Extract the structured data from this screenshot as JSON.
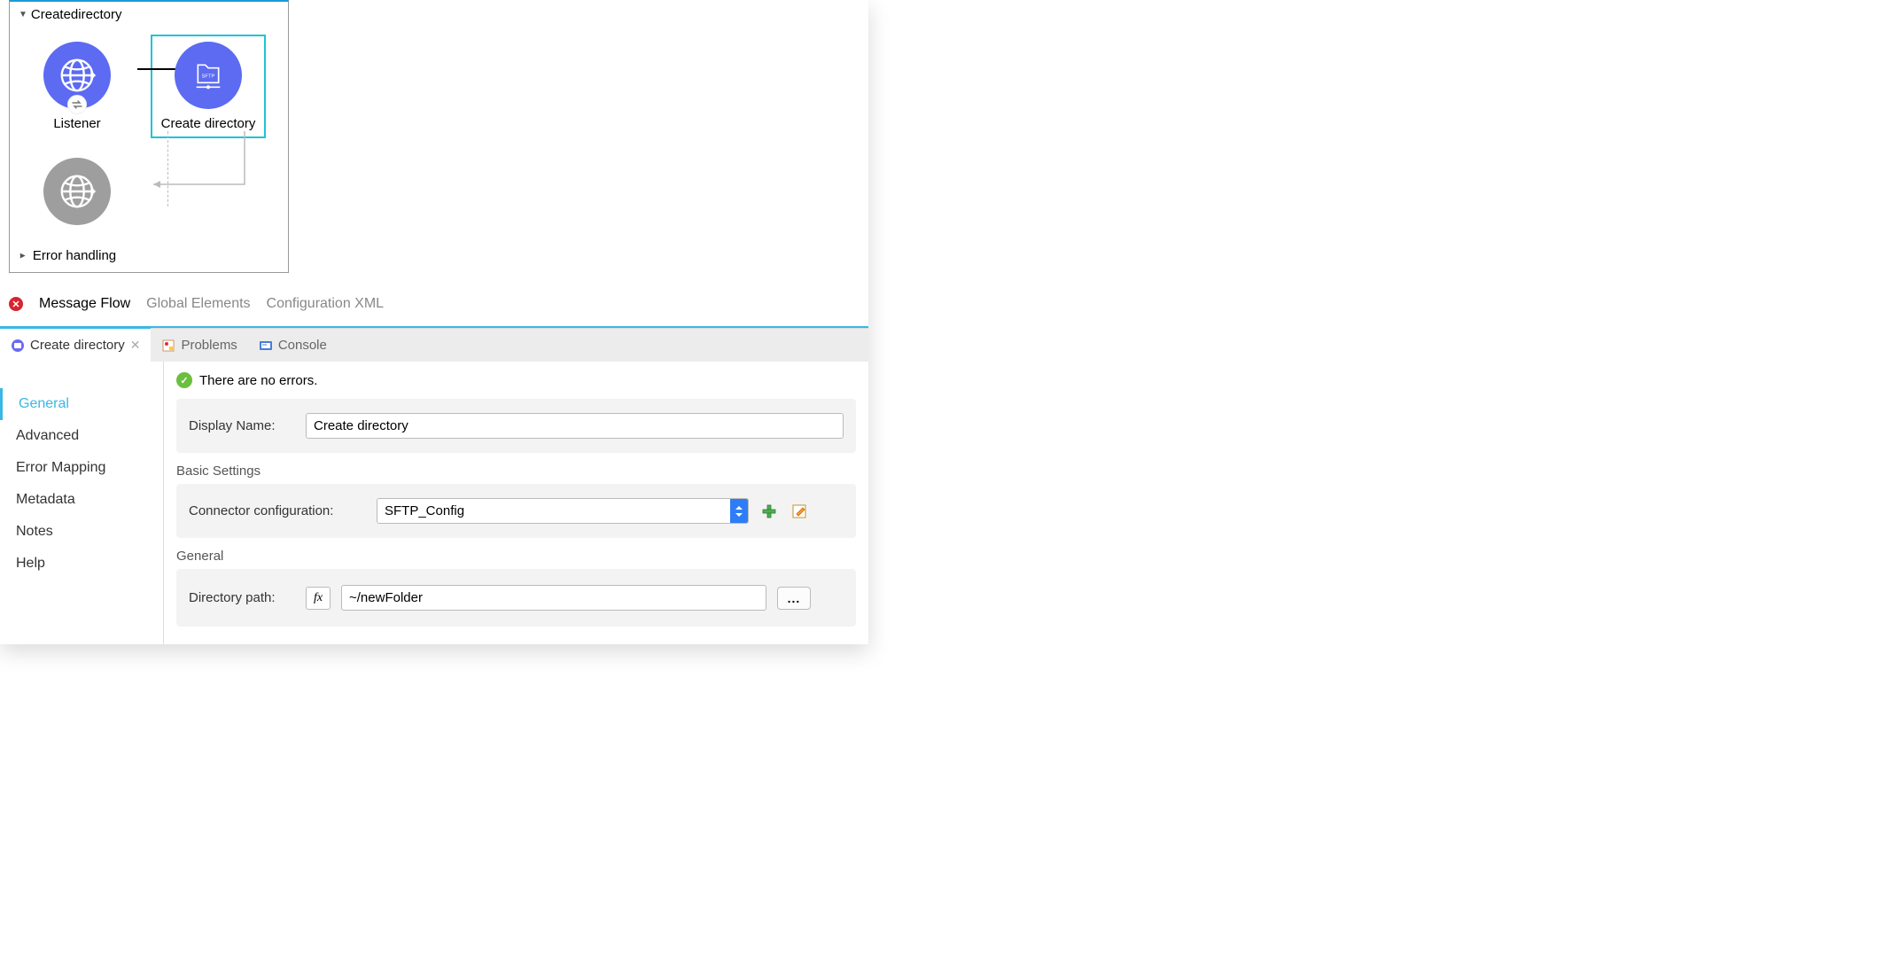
{
  "flow": {
    "title": "Createdirectory",
    "nodes": {
      "listener": {
        "label": "Listener"
      },
      "create_dir": {
        "label": "Create directory"
      }
    },
    "error_section": "Error handling"
  },
  "editor_tabs": {
    "message_flow": "Message Flow",
    "global_elements": "Global Elements",
    "config_xml": "Configuration XML"
  },
  "view_tabs": {
    "create_dir": "Create directory",
    "problems": "Problems",
    "console": "Console"
  },
  "side_nav": {
    "general": "General",
    "advanced": "Advanced",
    "error_mapping": "Error Mapping",
    "metadata": "Metadata",
    "notes": "Notes",
    "help": "Help"
  },
  "form": {
    "status": "There are no errors.",
    "display_name_label": "Display Name:",
    "display_name_value": "Create directory",
    "basic_settings_title": "Basic Settings",
    "connector_config_label": "Connector configuration:",
    "connector_config_value": "SFTP_Config",
    "general_title": "General",
    "directory_path_label": "Directory path:",
    "fx_label": "fx",
    "directory_path_value": "~/newFolder",
    "ellipsis": "..."
  }
}
